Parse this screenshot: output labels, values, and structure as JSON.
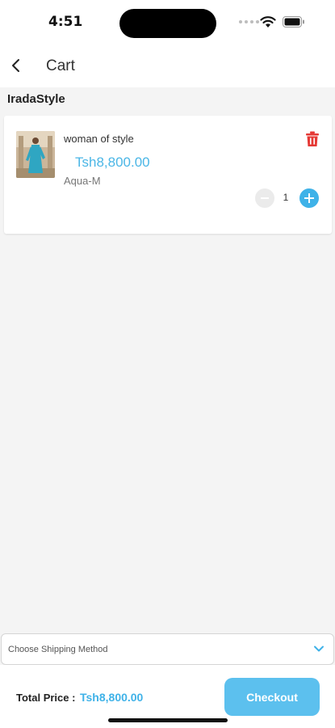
{
  "status_bar": {
    "time": "4:51"
  },
  "header": {
    "title": "Cart"
  },
  "store": {
    "name": "IradaStyle"
  },
  "cart": {
    "items": [
      {
        "name": "woman of style",
        "price": "Tsh8,800.00",
        "variant": "Aqua-M",
        "quantity": "1"
      }
    ]
  },
  "shipping": {
    "label": "Choose Shipping Method"
  },
  "footer": {
    "total_label": "Total Price :",
    "total_value": "Tsh8,800.00",
    "checkout_label": "Checkout"
  },
  "colors": {
    "accent": "#3fb2e8",
    "price": "#4ab6e6",
    "delete": "#e53935",
    "background": "#f4f4f4"
  },
  "icons": [
    "back-arrow-icon",
    "trash-icon",
    "minus-icon",
    "plus-icon",
    "chevron-down-icon",
    "wifi-icon",
    "battery-icon"
  ]
}
